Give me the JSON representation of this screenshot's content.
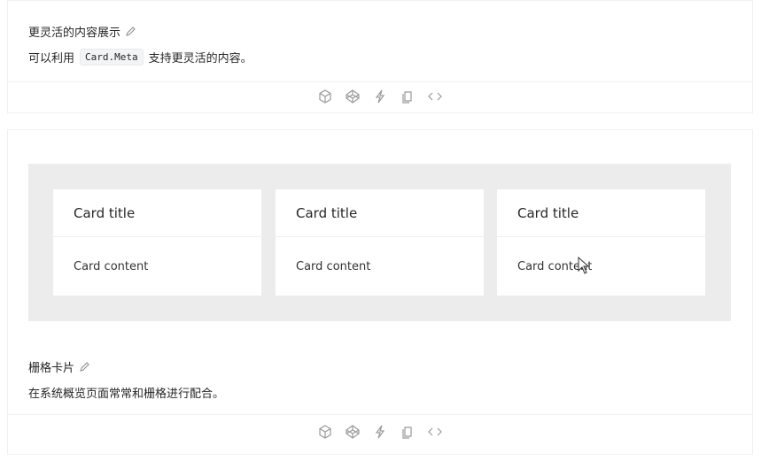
{
  "section1": {
    "title": "更灵活的内容展示",
    "desc_prefix": "可以利用",
    "desc_code": "Card.Meta",
    "desc_suffix": "支持更灵活的内容。"
  },
  "section2": {
    "title": "栅格卡片",
    "desc": "在系统概览页面常常和栅格进行配合。"
  },
  "cards": [
    {
      "title": "Card title",
      "content": "Card content"
    },
    {
      "title": "Card title",
      "content": "Card content"
    },
    {
      "title": "Card title",
      "content": "Card content"
    }
  ],
  "actions": [
    "codesandbox-icon",
    "codepen-icon",
    "stackblitz-icon",
    "copy-icon",
    "code-icon"
  ]
}
